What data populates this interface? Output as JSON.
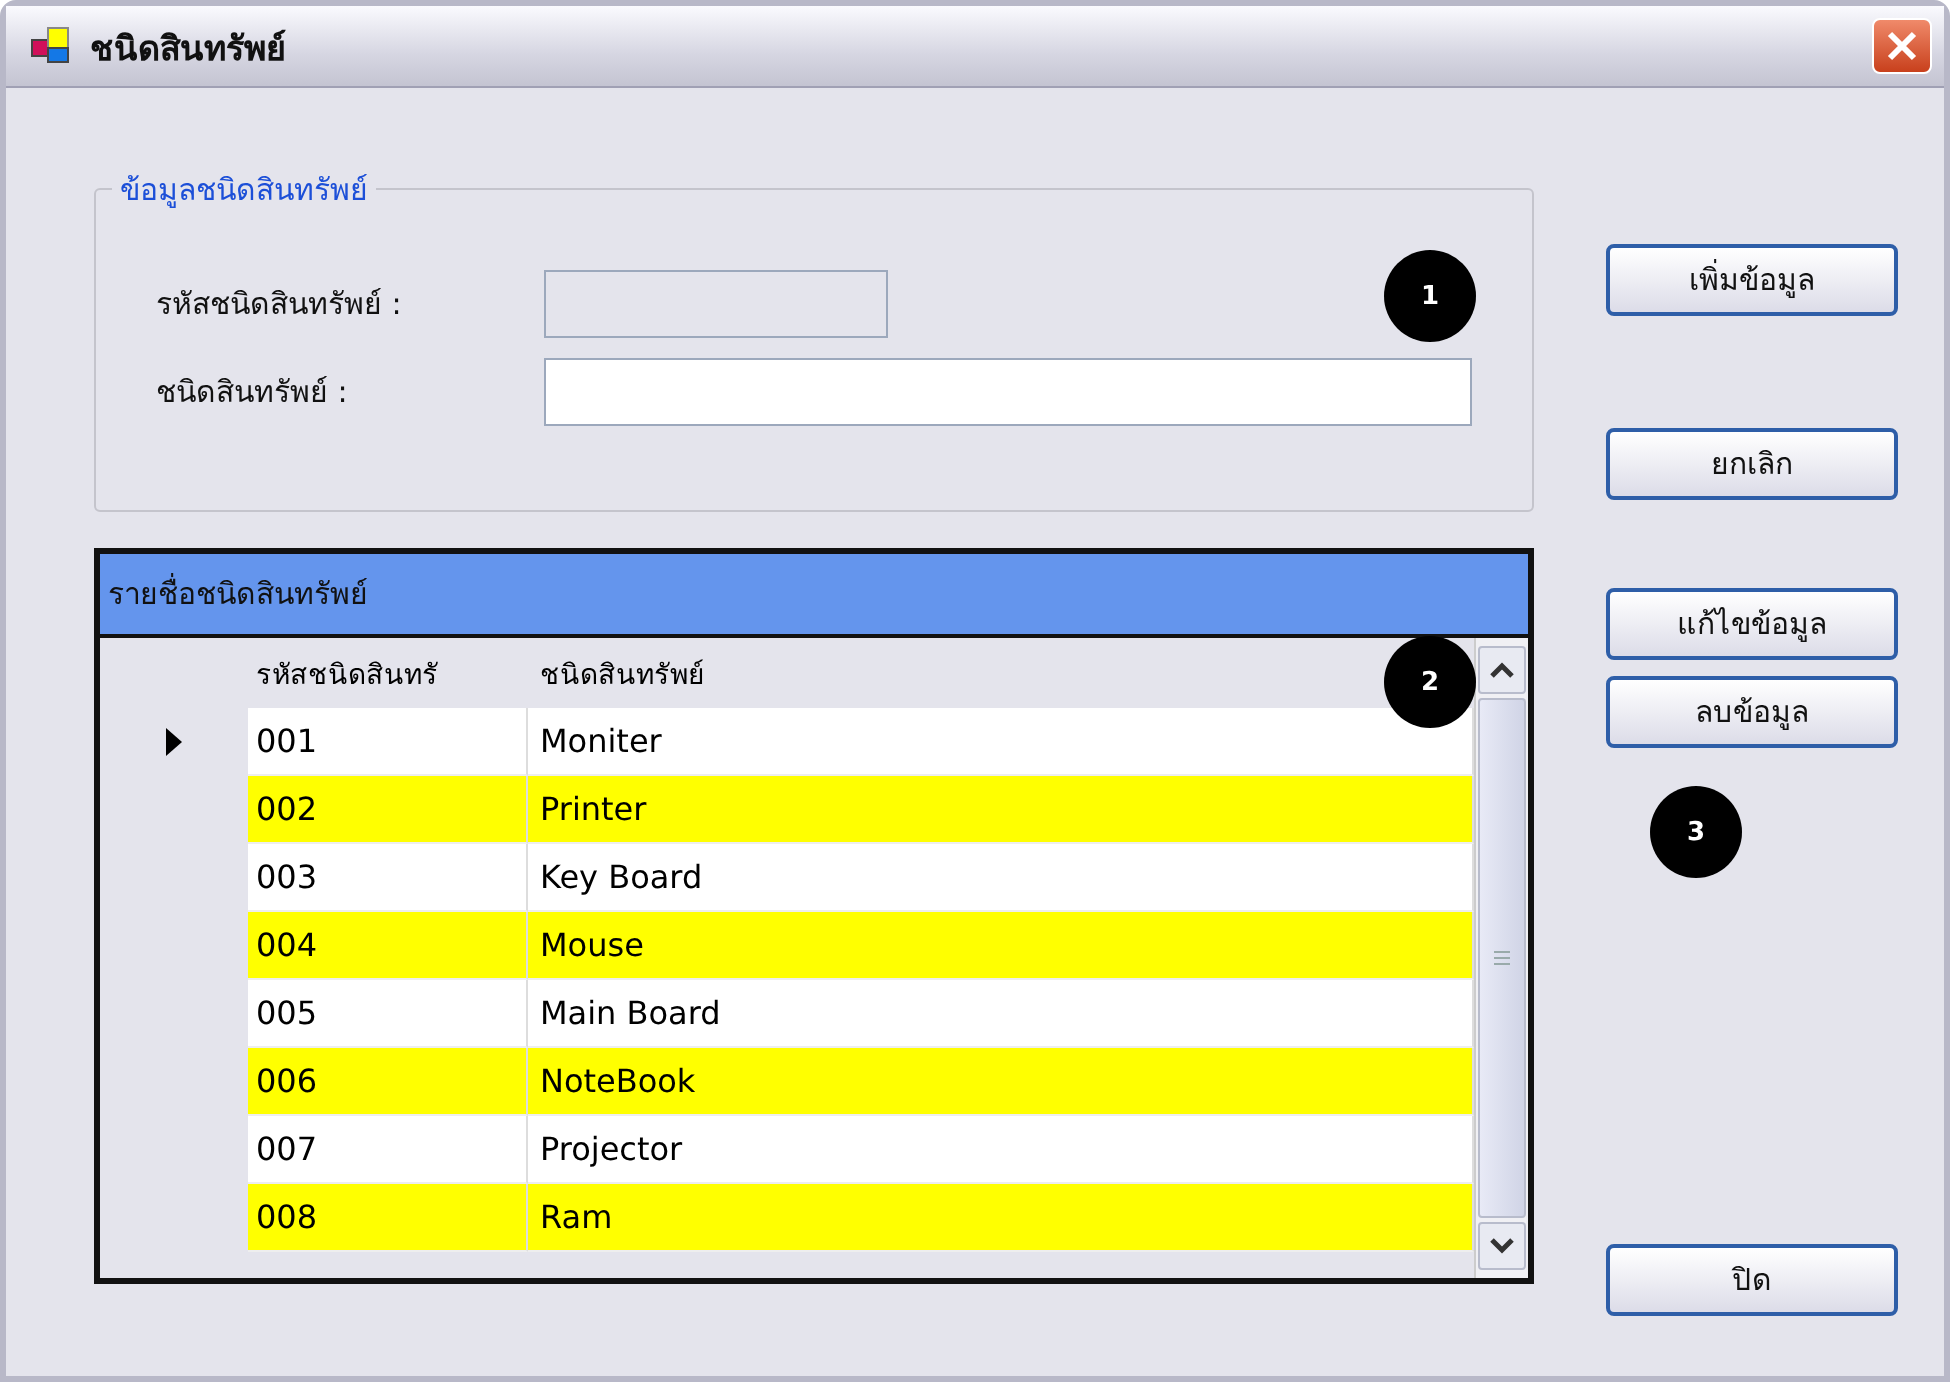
{
  "window": {
    "title": "ชนิดสินทรัพย์"
  },
  "group": {
    "title": "ข้อมูลชนิดสินทรัพย์",
    "fields": [
      {
        "label": "รหัสชนิดสินทรัพย์ :",
        "disabled": true
      },
      {
        "label": "ชนิดสินทรัพย์ :",
        "disabled": false
      }
    ]
  },
  "grid": {
    "caption": "รายชื่อชนิดสินทรัพย์",
    "columns": [
      "รหัสชนิดสินทรั",
      "ชนิดสินทรัพย์"
    ],
    "rows": [
      {
        "cells": [
          "001",
          "Moniter"
        ],
        "current": true,
        "highlighted": false
      },
      {
        "cells": [
          "002",
          "Printer"
        ],
        "current": false,
        "highlighted": true
      },
      {
        "cells": [
          "003",
          "Key Board"
        ],
        "current": false,
        "highlighted": false
      },
      {
        "cells": [
          "004",
          "Mouse"
        ],
        "current": false,
        "highlighted": true
      },
      {
        "cells": [
          "005",
          "Main Board"
        ],
        "current": false,
        "highlighted": false
      },
      {
        "cells": [
          "006",
          "NoteBook"
        ],
        "current": false,
        "highlighted": true
      },
      {
        "cells": [
          "007",
          "Projector"
        ],
        "current": false,
        "highlighted": false
      },
      {
        "cells": [
          "008",
          "Ram"
        ],
        "current": false,
        "highlighted": true
      }
    ]
  },
  "buttons": [
    {
      "label": "เพิ่มข้อมูล",
      "kind": "add"
    },
    {
      "label": "ยกเลิก",
      "kind": "cancel"
    },
    {
      "label": "แก้ไขข้อมูล",
      "kind": "edit"
    },
    {
      "label": "ลบข้อมูล",
      "kind": "delete"
    },
    {
      "label": "ปิด",
      "kind": "close"
    }
  ],
  "callouts": [
    "1",
    "2",
    "3"
  ]
}
